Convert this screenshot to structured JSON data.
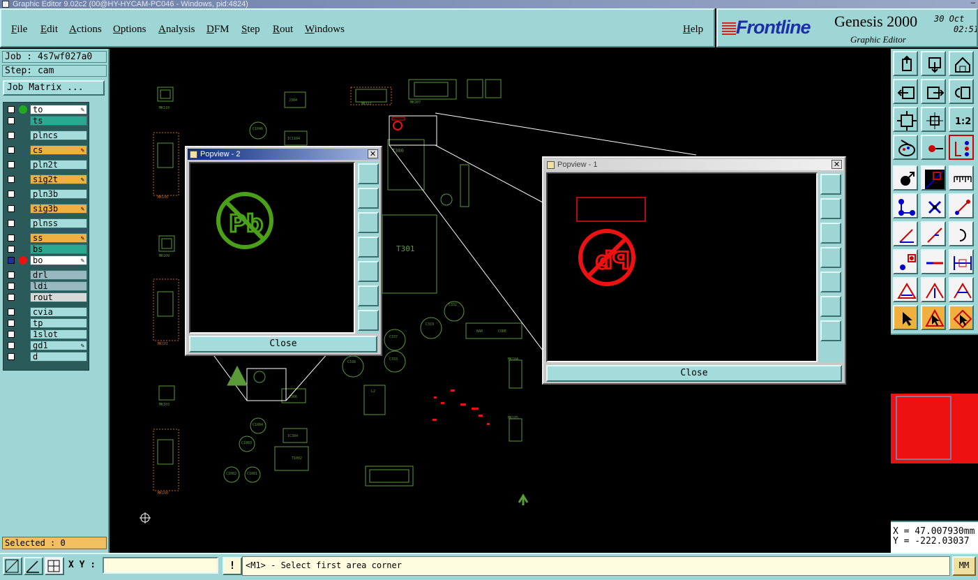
{
  "window": {
    "title": "Graphic Editor 9.02c2 (00@HY-HYCAM-PC046 - Windows, pid:4824)"
  },
  "menu": {
    "file": "File",
    "edit": "Edit",
    "actions": "Actions",
    "options": "Options",
    "analysis": "Analysis",
    "dfm": "DFM",
    "step": "Step",
    "rout": "Rout",
    "windows": "Windows",
    "help": "Help"
  },
  "brand": {
    "logo": "Frontline",
    "product": "Genesis 2000",
    "subtitle": "Graphic Editor",
    "date": "30 Oct",
    "time": "02:51"
  },
  "job": {
    "job_label": "Job : 4s7wf027a0",
    "step_label": "Step: cam",
    "matrix_button": "Job Matrix ..."
  },
  "layers": [
    {
      "name": "to",
      "color": "#ffffff",
      "dot": "#22aa22",
      "pen": true
    },
    {
      "name": "ts",
      "color": "#2aa890",
      "pen": false
    },
    {
      "name": "plncs",
      "color": "#a4dcdc",
      "pen": false
    },
    {
      "name": "cs",
      "color": "#f0b040",
      "pen": true
    },
    {
      "name": "pln2t",
      "color": "#a4dcdc",
      "pen": false
    },
    {
      "name": "sig2t",
      "color": "#f0b040",
      "pen": true
    },
    {
      "name": "pln3b",
      "color": "#a4dcdc",
      "pen": false
    },
    {
      "name": "sig3b",
      "color": "#f0b040",
      "pen": true
    },
    {
      "name": "plnss",
      "color": "#a4dcdc",
      "pen": false
    },
    {
      "name": "ss",
      "color": "#f0b040",
      "pen": true
    },
    {
      "name": "bs",
      "color": "#2aa890",
      "pen": false
    },
    {
      "name": "bo",
      "color": "#ffffff",
      "dot": "#ee1111",
      "pen": true
    },
    {
      "name": "drl",
      "color": "#98b8c0",
      "pen": false
    },
    {
      "name": "ldi",
      "color": "#98b8c0",
      "pen": false
    },
    {
      "name": "rout",
      "color": "#d8d8d8",
      "pen": false
    },
    {
      "name": "cvia",
      "color": "#a4dcdc",
      "pen": false
    },
    {
      "name": "tp",
      "color": "#a4dcdc",
      "pen": false
    },
    {
      "name": "1slot",
      "color": "#a4dcdc",
      "pen": false
    },
    {
      "name": "gd1",
      "color": "#a4dcdc",
      "pen": true
    },
    {
      "name": "d",
      "color": "#a4dcdc",
      "pen": false
    }
  ],
  "selected": "Selected : 0",
  "popview2": {
    "title": "Popview - 2",
    "close": "Close",
    "symbol": "Pb"
  },
  "popview1": {
    "title": "Popview - 1",
    "close": "Close",
    "symbol": "Pb"
  },
  "pcb_labels": {
    "t301": "T301",
    "bar": "BAR",
    "code": "CODE",
    "t300": "T300",
    "mk110": "MK110",
    "mk104": "MK104",
    "mk105": "MK105",
    "c337": "C337",
    "c333": "C333",
    "c332": "C332",
    "c319": "C319",
    "c338": "C338",
    "c1046": "C1046",
    "ic1104": "IC1104",
    "ic304": "IC304",
    "c1084": "C1084",
    "c1083": "C1083",
    "c1082": "C1082",
    "c1081": "C1081",
    "t1002": "T1002",
    "l2": "L2",
    "mk307": "MK307",
    "mk108": "MK108",
    "mk109": "MK109",
    "mk101": "MK101",
    "mk103": "MK103",
    "mk100": "MK100",
    "j306": "J306",
    "j304": "J304",
    "mk111": "MK111"
  },
  "coords": {
    "x": "X = 47.007930mm",
    "y": "Y = -222.03037"
  },
  "status": {
    "xy_label": "X Y :",
    "xy_value": "",
    "alert": "!",
    "prompt": "<M1> - Select first area corner",
    "units": "MM"
  },
  "colors": {
    "panel": "#9ed6d6",
    "board_green": "#5a9a38",
    "bottom_red": "#ee1111",
    "orange_outline": "#c86a20"
  }
}
